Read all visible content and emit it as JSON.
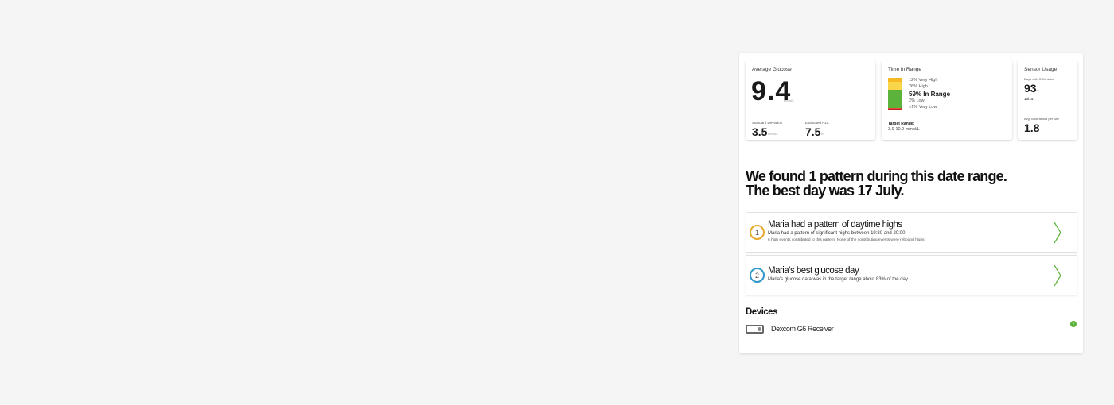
{
  "avg_glucose": {
    "title": "Average Glucose",
    "value": "9.4",
    "unit": "mmol/L",
    "std_label": "Standard Deviation",
    "std_value": "3.5",
    "std_unit": "mmol/L",
    "a1c_label": "Estimated A1C",
    "a1c_value": "7.5",
    "a1c_unit": "%"
  },
  "time_in_range": {
    "title": "Time in Range",
    "rows": [
      {
        "label": "12% Very High",
        "percent": 12,
        "color": "#f5b921"
      },
      {
        "label": "26% High",
        "percent": 26,
        "color": "#f9d54a"
      },
      {
        "label": "59% In Range",
        "percent": 59,
        "color": "#5bb33b"
      },
      {
        "label": "2% Low",
        "percent": 2,
        "color": "#e8493a"
      },
      {
        "label": "<1% Very Low",
        "percent": 1,
        "color": "#b8281f"
      }
    ],
    "target_label": "Target Range:",
    "target_value": "3.9-10.0 mmol/L"
  },
  "sensor_usage": {
    "title": "Sensor Usage",
    "days_label": "Days with CGM data",
    "days_value": "93",
    "days_unit": "%",
    "days_ratio": "13/14",
    "calib_label": "Avg. calibrations per day",
    "calib_value": "1.8"
  },
  "headline": {
    "line1": "We found 1 pattern during this date range.",
    "line2": "The best day was 17 July."
  },
  "patterns": [
    {
      "number": "1",
      "color": "#e8a92b",
      "title": "Maria had a pattern of daytime highs",
      "desc": "Maria had a pattern of significant highs between 19:30 and 20:00.",
      "desc2": "6 high events contributed to this pattern. None of the contributing events were rebound highs."
    },
    {
      "number": "2",
      "color": "#2f96c8",
      "title": "Maria's best glucose day",
      "desc": "Maria's glucose data was in the target range about 83% of the day.",
      "desc2": ""
    }
  ],
  "devices": {
    "title": "Devices",
    "device_name": "Dexcom G6 Receiver",
    "status_glyph": "›"
  },
  "colors": {
    "accent_green": "#5bb33b"
  },
  "icons": {
    "chevron": "chevron-right-icon",
    "device": "receiver-icon"
  }
}
